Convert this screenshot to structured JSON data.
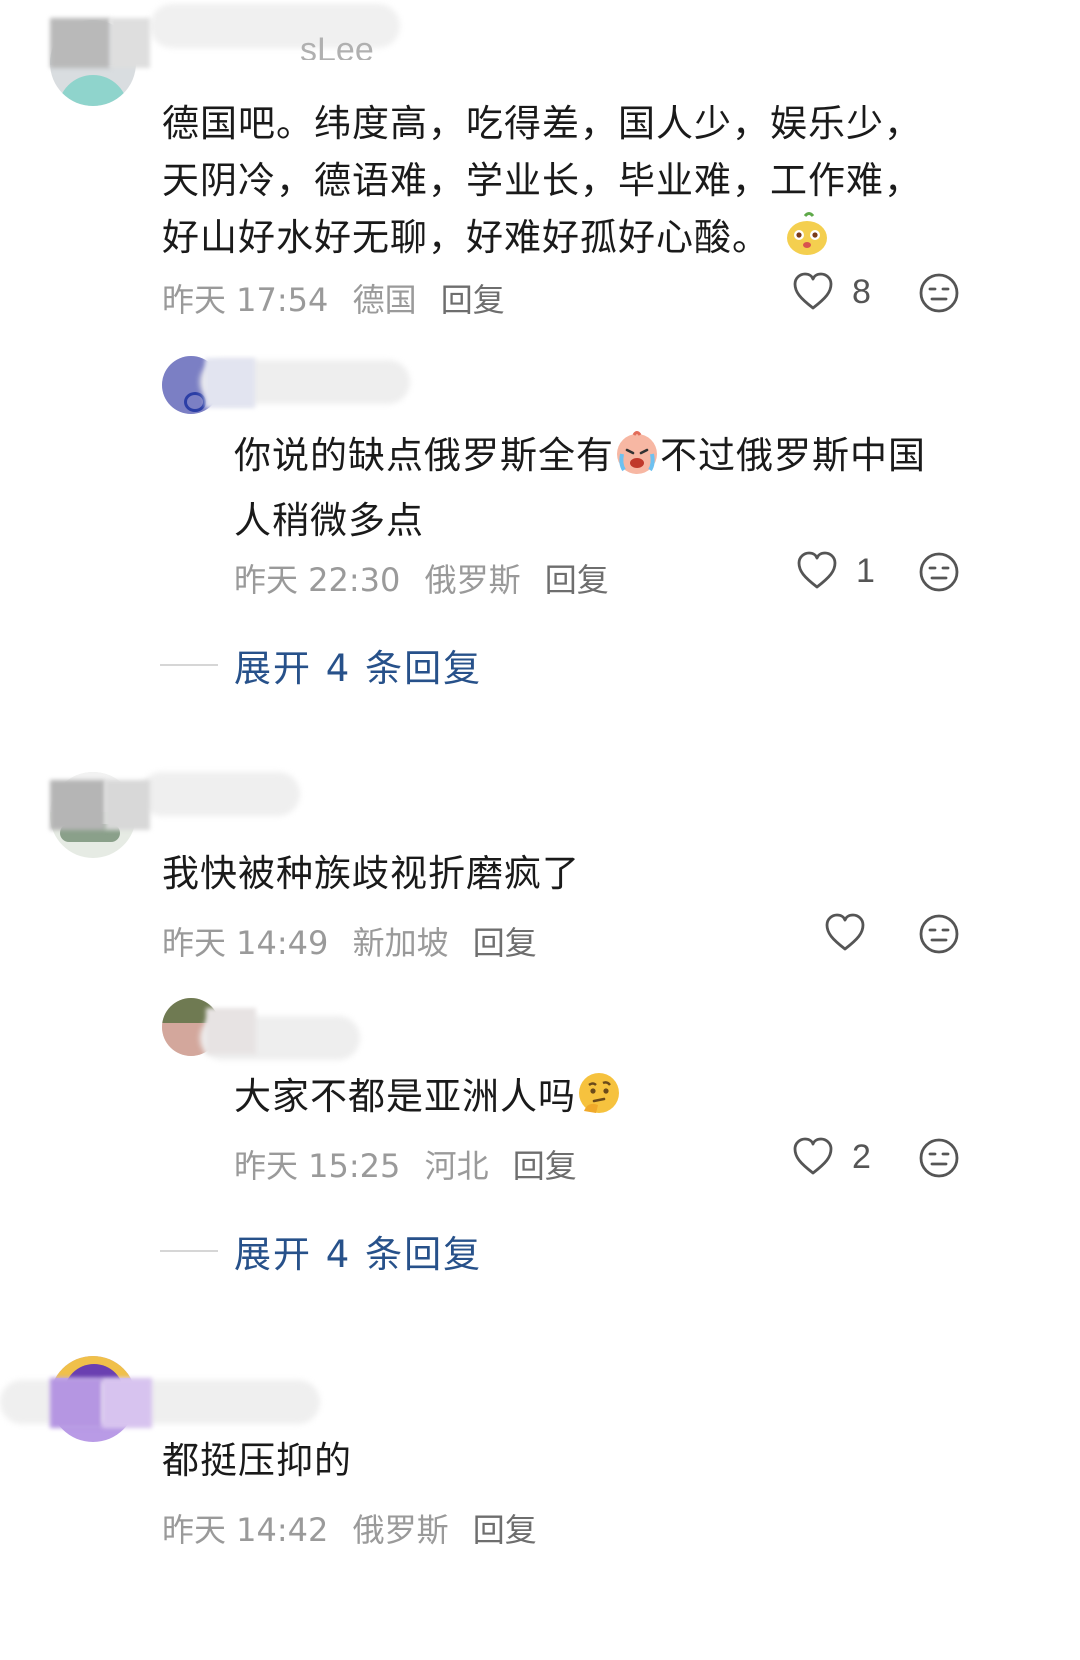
{
  "comments": [
    {
      "username_suffix": "sLee",
      "text_lines": [
        "德国吧。纬度高，吃得差，国人少，娱乐少，",
        "天阴冷，德语难，学业长，毕业难，工作难，",
        "好山好水好无聊，好难好孤好心酸。"
      ],
      "trailing_emoji": "cute-face-emoji",
      "time": "昨天 17:54",
      "location": "德国",
      "reply_label": "回复",
      "like_count": "8",
      "replies": [
        {
          "text_lines": [
            "你说的缺点俄罗斯全有",
            "人稍微多点"
          ],
          "inline_emoji": "crying-face-emoji",
          "text_after_emoji": "不过俄罗斯中国",
          "time": "昨天 22:30",
          "location": "俄罗斯",
          "reply_label": "回复",
          "like_count": "1"
        }
      ],
      "expand_label": "展开 4 条回复"
    },
    {
      "text_lines": [
        "我快被种族歧视折磨疯了"
      ],
      "time": "昨天 14:49",
      "location": "新加坡",
      "reply_label": "回复",
      "like_count": "",
      "replies": [
        {
          "text_lines": [
            "大家不都是亚洲人吗"
          ],
          "trailing_emoji": "thinking-face-emoji",
          "time": "昨天 15:25",
          "location": "河北",
          "reply_label": "回复",
          "like_count": "2"
        }
      ],
      "expand_label": "展开 4 条回复"
    },
    {
      "text_lines": [
        "都挺压抑的"
      ],
      "time": "昨天 14:42",
      "location": "俄罗斯",
      "reply_label": "回复"
    }
  ],
  "colors": {
    "expand_link": "#27518a",
    "meta_text": "#9a9a9a",
    "body_text": "#1a1a1a"
  }
}
